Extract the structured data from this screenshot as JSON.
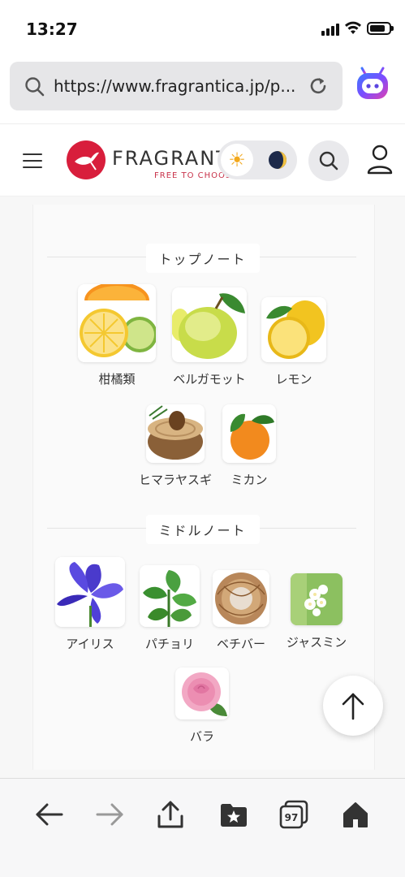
{
  "status": {
    "time": "13:27"
  },
  "browser": {
    "url": "https://www.fragrantica.jp/p...",
    "tab_count": "97"
  },
  "site": {
    "logo_text": "FRAGRANTICA",
    "tagline": "FREE TO CHOOSE"
  },
  "sections": {
    "top": {
      "title": "トップノート",
      "notes": [
        {
          "name": "柑橘類"
        },
        {
          "name": "ベルガモット"
        },
        {
          "name": "レモン"
        },
        {
          "name": "ヒマラヤスギ"
        },
        {
          "name": "ミカン"
        }
      ]
    },
    "middle": {
      "title": "ミドルノート",
      "notes": [
        {
          "name": "アイリス"
        },
        {
          "name": "パチョリ"
        },
        {
          "name": "ベチバー"
        },
        {
          "name": "ジャスミン"
        },
        {
          "name": "バラ"
        }
      ]
    }
  },
  "colors": {
    "brand": "#d81e3c",
    "accent_bot": "#7b4dff"
  }
}
